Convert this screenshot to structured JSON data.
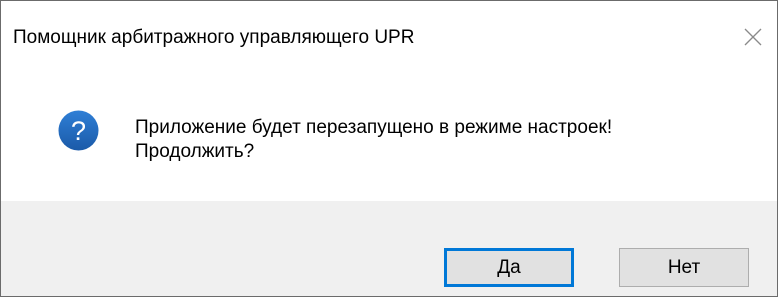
{
  "window": {
    "title": "Помощник арбитражного управляющего UPR",
    "close_icon": "close-icon"
  },
  "message": {
    "icon": "question-icon",
    "icon_color": "#1e63b5",
    "line1": "Приложение будет перезапущено в режиме настроек!",
    "line2": "Продолжить?"
  },
  "buttons": {
    "yes_label": "Да",
    "no_label": "Нет",
    "default_border_color": "#0078d7"
  }
}
